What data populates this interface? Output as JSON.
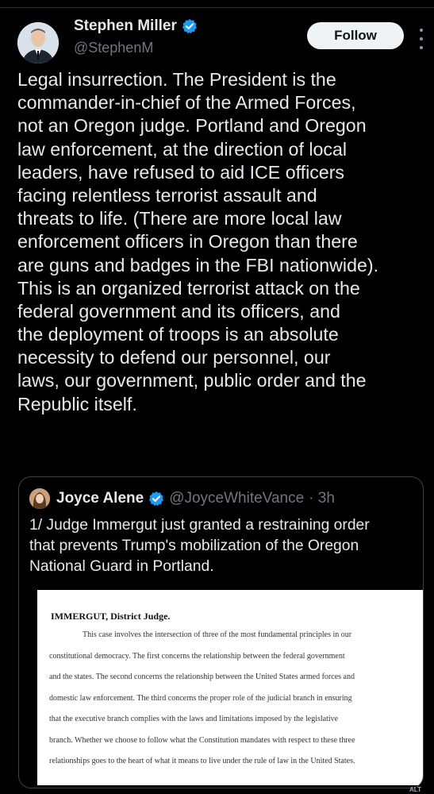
{
  "post": {
    "author_name": "Stephen Miller",
    "author_handle": "@StephenM",
    "follow_label": "Follow",
    "text_lines": [
      "Legal insurrection. The President is the",
      "commander-in-chief of the Armed Forces,",
      "not an Oregon judge. Portland and Oregon",
      "law enforcement, at the direction of local",
      "leaders, have refused to aid ICE officers",
      "facing relentless terrorist assault and",
      "threats to life. (There are more local law",
      "enforcement officers in Oregon than there",
      "are guns and badges in the FBI nationwide).",
      "This is an organized terrorist attack on the",
      "federal government and its officers, and",
      "the deployment of troops is an absolute",
      "necessity to defend our personnel, our",
      "laws, our government, public order and the",
      "Republic itself."
    ]
  },
  "quoted_post": {
    "author_name": "Joyce Alene",
    "author_handle": "@JoyceWhiteVance",
    "timestamp": "· 3h",
    "text_lines": [
      "1/ Judge Immergut just granted a restraining order",
      "that prevents Trump's mobilization of the Oregon",
      "National Guard in Portland."
    ],
    "document": {
      "heading": "IMMERGUT, District Judge.",
      "lines": [
        "This case involves the intersection of three of the most fundamental principles in our",
        "constitutional democracy. The first concerns the relationship between the federal government",
        "and the states. The second concerns the relationship between the United States armed forces and",
        "domestic law enforcement. The third concerns the proper role of the judicial branch in ensuring",
        "that the executive branch complies with the laws and limitations imposed by the legislative",
        "branch. Whether we choose to follow what the Constitution mandates with respect to these three",
        "relationships goes to the heart of what it means to live under the rule of law in the United States."
      ]
    }
  },
  "corner_badge": "ALT",
  "icons": {
    "verified": "verified-badge-icon",
    "more": "more-options-icon"
  },
  "colors": {
    "background": "#000000",
    "verified_blue": "#1d9bf0",
    "text_primary": "#e7e9ea",
    "text_secondary": "#71767b",
    "follow_bg": "#eff3f4"
  }
}
